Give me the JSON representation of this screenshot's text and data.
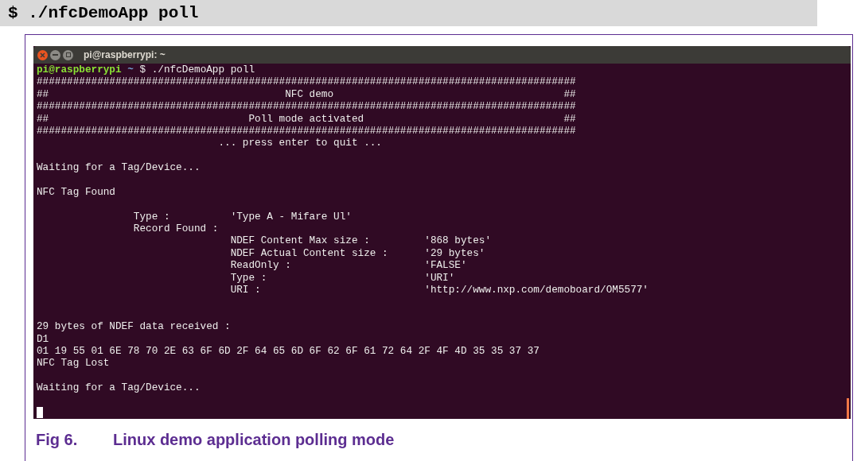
{
  "code_command": "$ ./nfcDemoApp poll",
  "terminal": {
    "title": "pi@raspberrypi: ~",
    "prompt": {
      "user": "pi@raspberrypi",
      "path": "~",
      "symbol": "$",
      "command": "./nfcDemoApp poll"
    },
    "lines": [
      {
        "kind": "output",
        "text": "#########################################################################################"
      },
      {
        "kind": "output",
        "text": "##                                       NFC demo                                      ##"
      },
      {
        "kind": "output",
        "text": "#########################################################################################"
      },
      {
        "kind": "output",
        "text": "##                                 Poll mode activated                                 ##"
      },
      {
        "kind": "output",
        "text": "#########################################################################################"
      },
      {
        "kind": "output",
        "text": "                              ... press enter to quit ..."
      },
      {
        "kind": "blank"
      },
      {
        "kind": "output",
        "text": "Waiting for a Tag/Device..."
      },
      {
        "kind": "blank"
      },
      {
        "kind": "output",
        "text": "NFC Tag Found"
      },
      {
        "kind": "blank"
      },
      {
        "kind": "output",
        "text": "                Type :          'Type A - Mifare Ul'"
      },
      {
        "kind": "output",
        "text": "                Record Found :"
      },
      {
        "kind": "output",
        "text": "                                NDEF Content Max size :         '868 bytes'"
      },
      {
        "kind": "output",
        "text": "                                NDEF Actual Content size :      '29 bytes'"
      },
      {
        "kind": "output",
        "text": "                                ReadOnly :                      'FALSE'"
      },
      {
        "kind": "output",
        "text": "                                Type :                          'URI'"
      },
      {
        "kind": "output",
        "text": "                                URI :                           'http://www.nxp.com/demoboard/OM5577'"
      },
      {
        "kind": "blank"
      },
      {
        "kind": "blank"
      },
      {
        "kind": "output",
        "text": "29 bytes of NDEF data received :"
      },
      {
        "kind": "output",
        "text": "D1"
      },
      {
        "kind": "output",
        "text": "01 19 55 01 6E 78 70 2E 63 6F 6D 2F 64 65 6D 6F 62 6F 61 72 64 2F 4F 4D 35 35 37 37"
      },
      {
        "kind": "output",
        "text": "NFC Tag Lost"
      },
      {
        "kind": "blank"
      },
      {
        "kind": "output",
        "text": "Waiting for a Tag/Device..."
      },
      {
        "kind": "blank"
      },
      {
        "kind": "cursor"
      }
    ]
  },
  "caption": {
    "number": "Fig 6.",
    "text": "Linux demo application polling mode"
  }
}
